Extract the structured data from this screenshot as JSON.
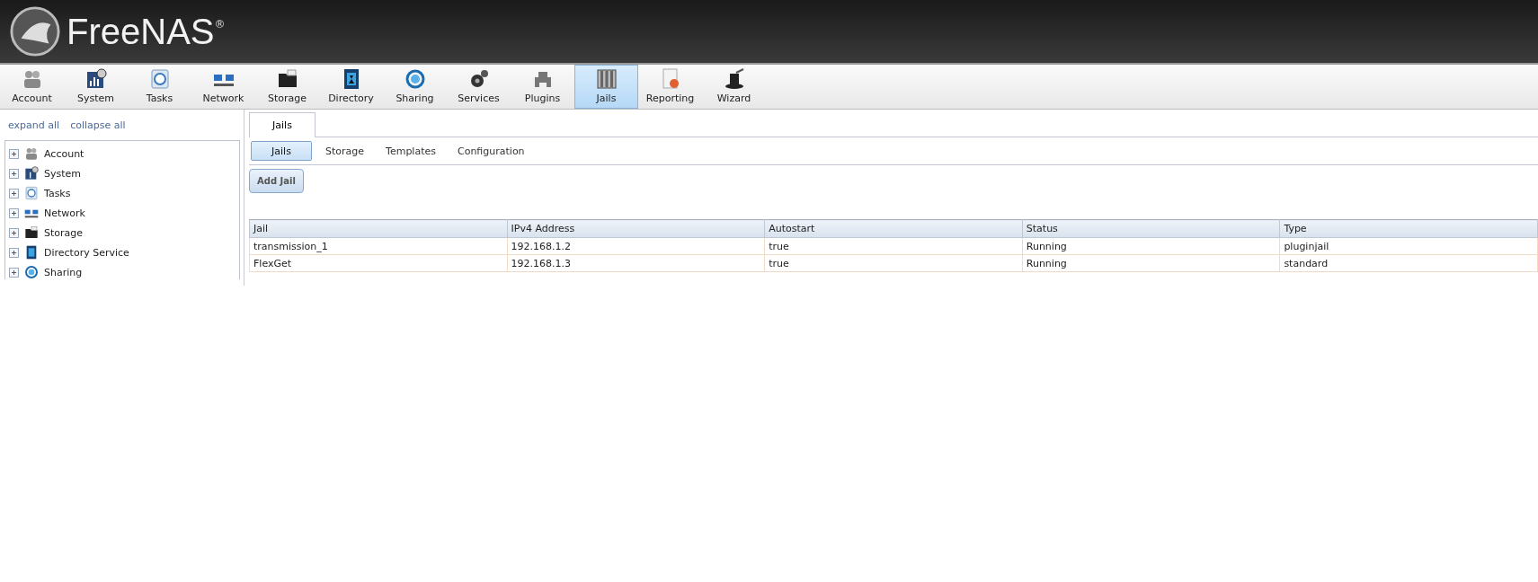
{
  "header": {
    "logo": "FreeNAS",
    "mark": "®"
  },
  "toolbar": [
    {
      "label": "Account",
      "selected": false
    },
    {
      "label": "System",
      "selected": false
    },
    {
      "label": "Tasks",
      "selected": false
    },
    {
      "label": "Network",
      "selected": false
    },
    {
      "label": "Storage",
      "selected": false
    },
    {
      "label": "Directory",
      "selected": false
    },
    {
      "label": "Sharing",
      "selected": false
    },
    {
      "label": "Services",
      "selected": false
    },
    {
      "label": "Plugins",
      "selected": false
    },
    {
      "label": "Jails",
      "selected": true
    },
    {
      "label": "Reporting",
      "selected": false
    },
    {
      "label": "Wizard",
      "selected": false
    }
  ],
  "sidebar": {
    "links": [
      "expand all",
      "collapse all"
    ],
    "tree": [
      {
        "label": "Account",
        "expanded": false
      },
      {
        "label": "System",
        "expanded": false
      },
      {
        "label": "Tasks",
        "expanded": false
      },
      {
        "label": "Network",
        "expanded": false
      },
      {
        "label": "Storage",
        "expanded": false
      },
      {
        "label": "Directory Service",
        "expanded": false
      },
      {
        "label": "Sharing",
        "expanded": false
      }
    ]
  },
  "tabs": [
    {
      "label": "Jails",
      "selected": true
    }
  ],
  "subtabs": [
    {
      "label": "Jails",
      "selected": true
    },
    {
      "label": "Storage",
      "selected": false
    },
    {
      "label": "Templates",
      "selected": false
    },
    {
      "label": "Configuration",
      "selected": false
    }
  ],
  "add_button": "Add Jail",
  "table": {
    "columns": [
      "Jail",
      "IPv4 Address",
      "Autostart",
      "Status",
      "Type"
    ],
    "rows": [
      [
        "transmission_1",
        "192.168.1.2",
        "true",
        "Running",
        "pluginjail"
      ],
      [
        "FlexGet",
        "192.168.1.3",
        "true",
        "Running",
        "standard"
      ]
    ]
  }
}
